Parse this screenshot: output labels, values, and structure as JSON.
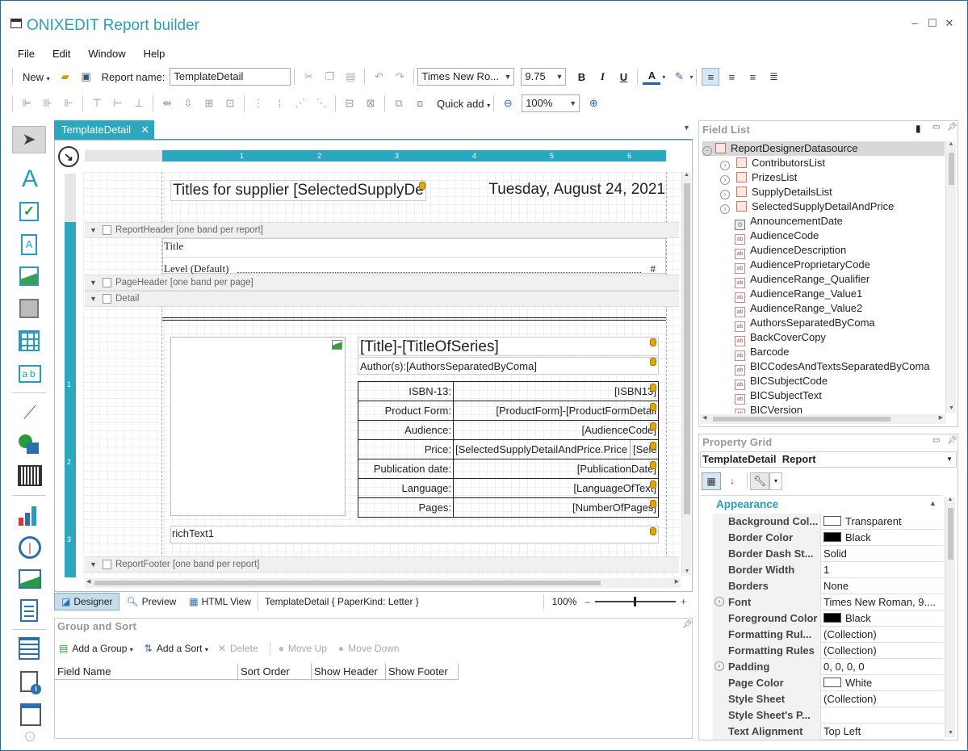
{
  "app": {
    "title": "ONIXEDIT Report builder"
  },
  "menu": [
    "File",
    "Edit",
    "Window",
    "Help"
  ],
  "toolbar1": {
    "new_label": "New",
    "report_name_label": "Report name:",
    "report_name_value": "TemplateDetail",
    "font_family": "Times New Ro...",
    "font_size": "9.75",
    "bold": "B",
    "italic": "I",
    "underline": "U",
    "font_color": "A"
  },
  "toolbar2": {
    "quick_add": "Quick add",
    "zoom": "100%"
  },
  "doc_tab": {
    "label": "TemplateDetail"
  },
  "ruler": {
    "top": [
      "1",
      "2",
      "3",
      "4",
      "5",
      "6"
    ],
    "left": [
      "1",
      "2",
      "3"
    ]
  },
  "report": {
    "title_text": "Titles for supplier [SelectedSupplyDe",
    "date_text": "Tuesday, August 24, 2021",
    "bands": {
      "report_header": "ReportHeader [one band per report]",
      "page_header": "PageHeader [one band per page]",
      "detail": "Detail",
      "report_footer": "ReportFooter [one band per report]"
    },
    "toc_title": "Title",
    "toc_level": "Level  (Default)",
    "toc_hash": "#",
    "series_title": "[Title]-[TitleOfSeries]",
    "authors": "Author(s):[AuthorsSeparatedByComa]",
    "rich_text": "richText1",
    "product_rows": [
      {
        "k": "ISBN-13:",
        "v": "[ISBN13]"
      },
      {
        "k": "Product Form:",
        "v": "[ProductForm]-[ProductFormDetail"
      },
      {
        "k": "Audience:",
        "v": "[AudienceCode]"
      },
      {
        "k": "Price:",
        "v": "[SelectedSupplyDetailAndPrice.Price",
        "v2": "[Sele"
      },
      {
        "k": "Publication date:",
        "v": "[PublicationDate]"
      },
      {
        "k": "Language:",
        "v": "[LanguageOfText]"
      },
      {
        "k": "Pages:",
        "v": "[NumberOfPages]"
      }
    ]
  },
  "bottom_tabs": {
    "designer": "Designer",
    "preview": "Preview",
    "html_view": "HTML View",
    "status": "TemplateDetail { PaperKind: Letter }",
    "zoom": "100%"
  },
  "group_sort": {
    "title": "Group and Sort",
    "add_group": "Add a Group",
    "add_sort": "Add a Sort",
    "delete": "Delete",
    "move_up": "Move Up",
    "move_down": "Move Down",
    "columns": [
      "Field Name",
      "Sort Order",
      "Show Header",
      "Show Footer"
    ]
  },
  "field_list": {
    "title": "Field List",
    "root": "ReportDesignerDatasource",
    "items": [
      {
        "label": "ContributorsList",
        "type": "table"
      },
      {
        "label": "PrizesList",
        "type": "table"
      },
      {
        "label": "SupplyDetailsList",
        "type": "table"
      },
      {
        "label": "SelectedSupplyDetailAndPrice",
        "type": "table"
      },
      {
        "label": "AnnouncementDate",
        "type": "date"
      },
      {
        "label": "AudienceCode",
        "type": "text"
      },
      {
        "label": "AudienceDescription",
        "type": "text"
      },
      {
        "label": "AudienceProprietaryCode",
        "type": "text"
      },
      {
        "label": "AudienceRange_Qualifier",
        "type": "text"
      },
      {
        "label": "AudienceRange_Value1",
        "type": "text"
      },
      {
        "label": "AudienceRange_Value2",
        "type": "text"
      },
      {
        "label": "AuthorsSeparatedByComa",
        "type": "text"
      },
      {
        "label": "BackCoverCopy",
        "type": "text"
      },
      {
        "label": "Barcode",
        "type": "text"
      },
      {
        "label": "BICCodesAndTextsSeparatedByComa",
        "type": "text"
      },
      {
        "label": "BICSubjectCode",
        "type": "text"
      },
      {
        "label": "BICSubjectText",
        "type": "text"
      },
      {
        "label": "BICVersion",
        "type": "text"
      }
    ]
  },
  "property_grid": {
    "title": "Property Grid",
    "object_name": "TemplateDetail",
    "object_type": "Report",
    "category": "Appearance",
    "rows": [
      {
        "k": "Background Col...",
        "v": "Transparent",
        "swatch": "#ffffff"
      },
      {
        "k": "Border Color",
        "v": "Black",
        "swatch": "#000000"
      },
      {
        "k": "Border Dash St...",
        "v": "Solid"
      },
      {
        "k": "Border Width",
        "v": "1"
      },
      {
        "k": "Borders",
        "v": "None"
      },
      {
        "k": "Font",
        "v": "Times New Roman, 9....",
        "expand": true
      },
      {
        "k": "Foreground Color",
        "v": "Black",
        "swatch": "#000000"
      },
      {
        "k": "Formatting Rul...",
        "v": "(Collection)"
      },
      {
        "k": "Formatting Rules",
        "v": "(Collection)"
      },
      {
        "k": "Padding",
        "v": "0, 0, 0, 0",
        "expand": true
      },
      {
        "k": "Page Color",
        "v": "White",
        "swatch": "#ffffff"
      },
      {
        "k": "Style Sheet",
        "v": "(Collection)"
      },
      {
        "k": "Style Sheet's P...",
        "v": ""
      },
      {
        "k": "Text Alignment",
        "v": "Top Left"
      }
    ]
  }
}
